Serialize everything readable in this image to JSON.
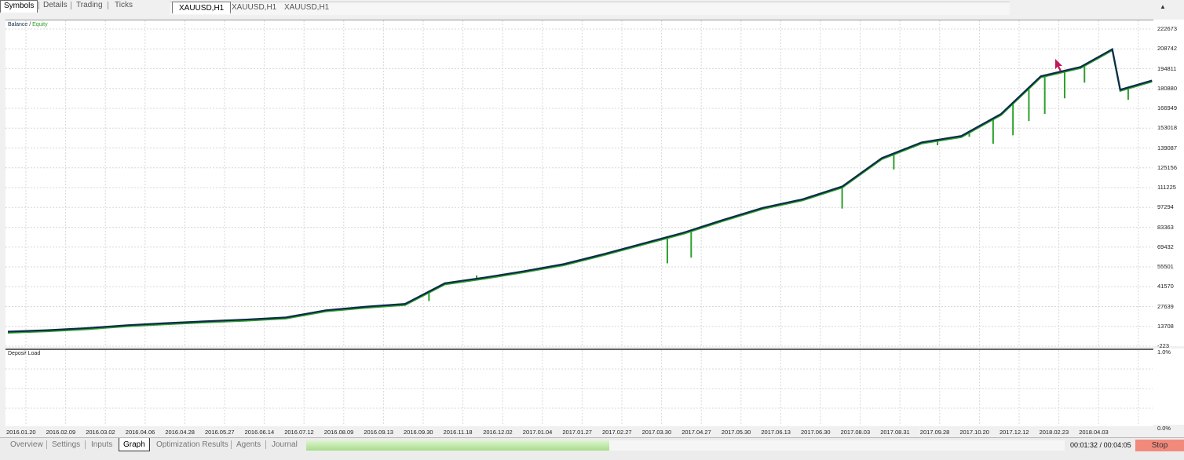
{
  "top_tabs": [
    "Symbols",
    "Details",
    "Trading",
    "Ticks"
  ],
  "symbol_tabs": [
    "XAUUSD,H1",
    "XAUUSD,H1",
    "XAUUSD,H1"
  ],
  "legend": {
    "balance": "Balance",
    "separator": " / ",
    "equity": "Equity"
  },
  "lower_panel_label": "Deposit Load",
  "lower_axis": {
    "top": "1.0%",
    "bottom": "0.0%"
  },
  "bottom_tabs": [
    "Overview",
    "Settings",
    "Inputs",
    "Graph",
    "Optimization Results",
    "Agents",
    "Journal"
  ],
  "active_bottom_tab": "Graph",
  "timer": {
    "elapsed": "00:01:32",
    "separator": " / ",
    "total": "00:04:05"
  },
  "stop_label": "Stop",
  "colors": {
    "balance": "#0d2a4a",
    "equity": "#2ca02c",
    "grid": "#d8d8d8",
    "stop": "#f28a7c"
  },
  "progress": 0.4,
  "chart_data": {
    "type": "line",
    "title": "",
    "y_ticks": [
      222673,
      208742,
      194811,
      180880,
      166949,
      153018,
      139087,
      125156,
      111225,
      97294,
      83363,
      69432,
      55501,
      41570,
      27639,
      13708,
      -223
    ],
    "x_ticks": [
      "2016.01.20",
      "2016.02.09",
      "2016.03.02",
      "2016.04.06",
      "2016.04.28",
      "2016.05.27",
      "2016.06.14",
      "2016.07.12",
      "2016.08.09",
      "2016.09.13",
      "2016.09.30",
      "2016.11.18",
      "2016.12.02",
      "2017.01.04",
      "2017.01.27",
      "2017.02.27",
      "2017.03.30",
      "2017.04.27",
      "2017.05.30",
      "2017.06.13",
      "2017.06.30",
      "2017.08.03",
      "2017.08.31",
      "2017.09.28",
      "2017.10.20",
      "2017.12.12",
      "2018.02.23",
      "2018.04.03"
    ],
    "ylim": [
      -223,
      222673
    ],
    "series": [
      {
        "name": "Balance",
        "x": [
          0,
          1,
          2,
          3,
          4,
          5,
          6,
          7,
          8,
          9,
          10,
          11,
          12,
          13,
          14,
          15,
          16,
          17,
          18,
          19,
          20,
          21,
          22,
          23,
          24,
          25,
          26,
          27,
          27.8,
          28.0,
          28.8
        ],
        "values": [
          10000,
          11000,
          12500,
          14500,
          16000,
          17300,
          18500,
          20000,
          25000,
          27500,
          29500,
          44000,
          48000,
          52500,
          57500,
          64500,
          72000,
          79500,
          88500,
          97000,
          103000,
          112000,
          132000,
          143000,
          147500,
          163000,
          189500,
          196000,
          208500,
          180000,
          186500
        ]
      },
      {
        "name": "Equity",
        "drawdowns": [
          {
            "x": 21.0,
            "value": 96500
          },
          {
            "x": 22.3,
            "value": 124000
          },
          {
            "x": 23.4,
            "value": 141000
          },
          {
            "x": 24.2,
            "value": 147000
          },
          {
            "x": 24.8,
            "value": 142000
          },
          {
            "x": 25.3,
            "value": 148000
          },
          {
            "x": 25.7,
            "value": 158000
          },
          {
            "x": 26.1,
            "value": 163000
          },
          {
            "x": 26.6,
            "value": 174000
          },
          {
            "x": 27.1,
            "value": 185000
          },
          {
            "x": 28.2,
            "value": 173000
          },
          {
            "x": 16.6,
            "value": 58000
          },
          {
            "x": 11.8,
            "value": 49500
          },
          {
            "x": 10.6,
            "value": 31500
          },
          {
            "x": 17.2,
            "value": 62000
          }
        ]
      }
    ]
  }
}
